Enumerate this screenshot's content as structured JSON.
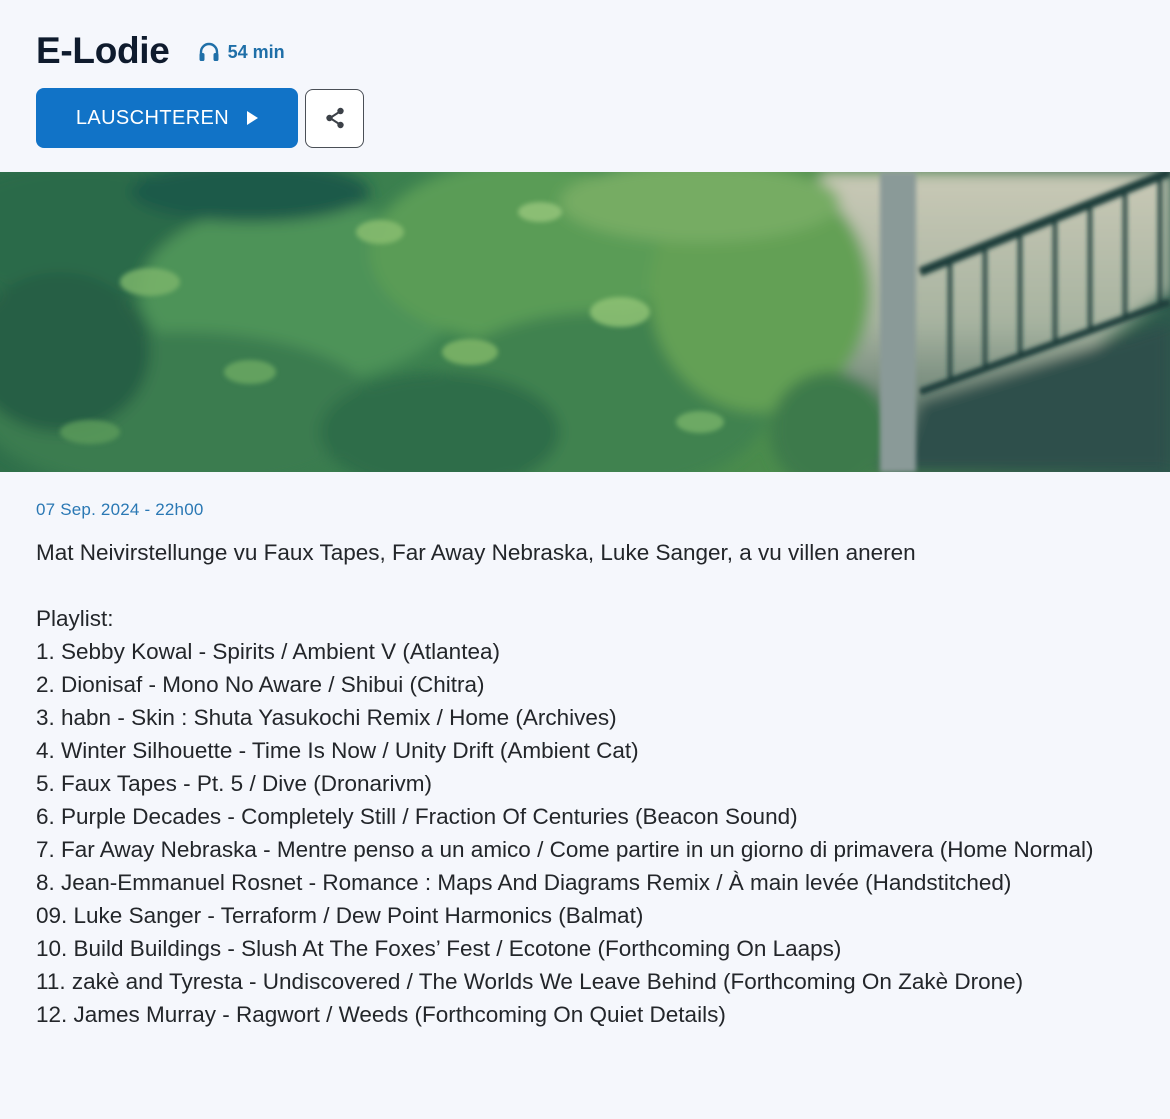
{
  "show": {
    "title": "E-Lodie",
    "duration": "54 min",
    "listen_label": "LAUSCHTEREN",
    "date": "07 Sep. 2024 - 22h00",
    "description": "Mat Neivirstellunge vu Faux Tapes, Far Away Nebraska, Luke Sanger, a vu villen aneren"
  },
  "icons": {
    "duration": "headphones-icon",
    "listen": "play-icon",
    "share": "share-icon"
  },
  "colors": {
    "accent": "#1173c7",
    "date": "#2a78b4",
    "title": "#0f1b2d",
    "background": "#f5f7fc"
  },
  "playlist": {
    "label": "Playlist:",
    "tracks": [
      "1. Sebby Kowal - Spirits / Ambient V (Atlantea)",
      "2. Dionisaf - Mono No Aware / Shibui (Chitra)",
      "3. habn - Skin : Shuta Yasukochi Remix / Home (Archives)",
      "4. Winter Silhouette - Time Is Now / Unity Drift (Ambient Cat)",
      "5. Faux Tapes - Pt. 5 / Dive (Dronarivm)",
      "6. Purple Decades - Completely Still / Fraction Of Centuries (Beacon Sound)",
      "7. Far Away Nebraska - Mentre penso a un amico / Come partire in un giorno di primavera (Home Normal)",
      "8. Jean-Emmanuel Rosnet - Romance : Maps And Diagrams Remix / À main levée (Handstitched)",
      "09. Luke Sanger - Terraform / Dew Point Harmonics (Balmat)",
      "10. Build Buildings - Slush At The Foxes’ Fest / Ecotone (Forthcoming On Laaps)",
      "11. zakè and Tyresta - Undiscovered / The Worlds We Leave Behind (Forthcoming On Zakè Drone)",
      "12. James Murray - Ragwort / Weeds (Forthcoming On Quiet Details)"
    ]
  }
}
